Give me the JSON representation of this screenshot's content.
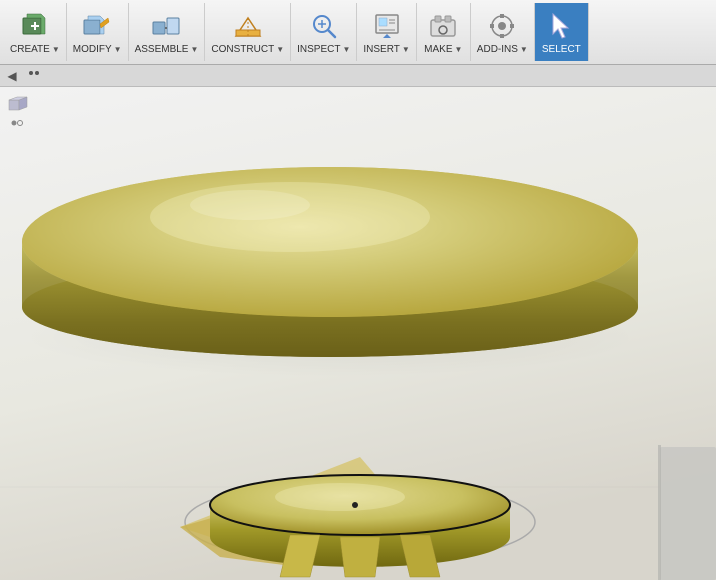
{
  "toolbar": {
    "groups": [
      {
        "id": "create",
        "label": "CREATE",
        "icon": "⬛",
        "has_arrow": true
      },
      {
        "id": "modify",
        "label": "MODIFY",
        "icon": "🔧",
        "has_arrow": true
      },
      {
        "id": "assemble",
        "label": "ASSEMBLE",
        "icon": "🔩",
        "has_arrow": true
      },
      {
        "id": "construct",
        "label": "CONSTRUCT",
        "icon": "📐",
        "has_arrow": true
      },
      {
        "id": "inspect",
        "label": "INSPECT",
        "icon": "🔍",
        "has_arrow": true
      },
      {
        "id": "insert",
        "label": "INSERT",
        "icon": "📥",
        "has_arrow": true
      },
      {
        "id": "make",
        "label": "MAKE",
        "icon": "🏭",
        "has_arrow": true
      },
      {
        "id": "add-ins",
        "label": "ADD-INS",
        "icon": "⚙️",
        "has_arrow": true
      },
      {
        "id": "select",
        "label": "SELECT",
        "icon": "↖",
        "has_arrow": false,
        "active": true
      }
    ]
  },
  "subtoolbar": {
    "icons": [
      "⬅",
      "🔲"
    ]
  },
  "viewport": {
    "background_color": "#eeeeee"
  }
}
